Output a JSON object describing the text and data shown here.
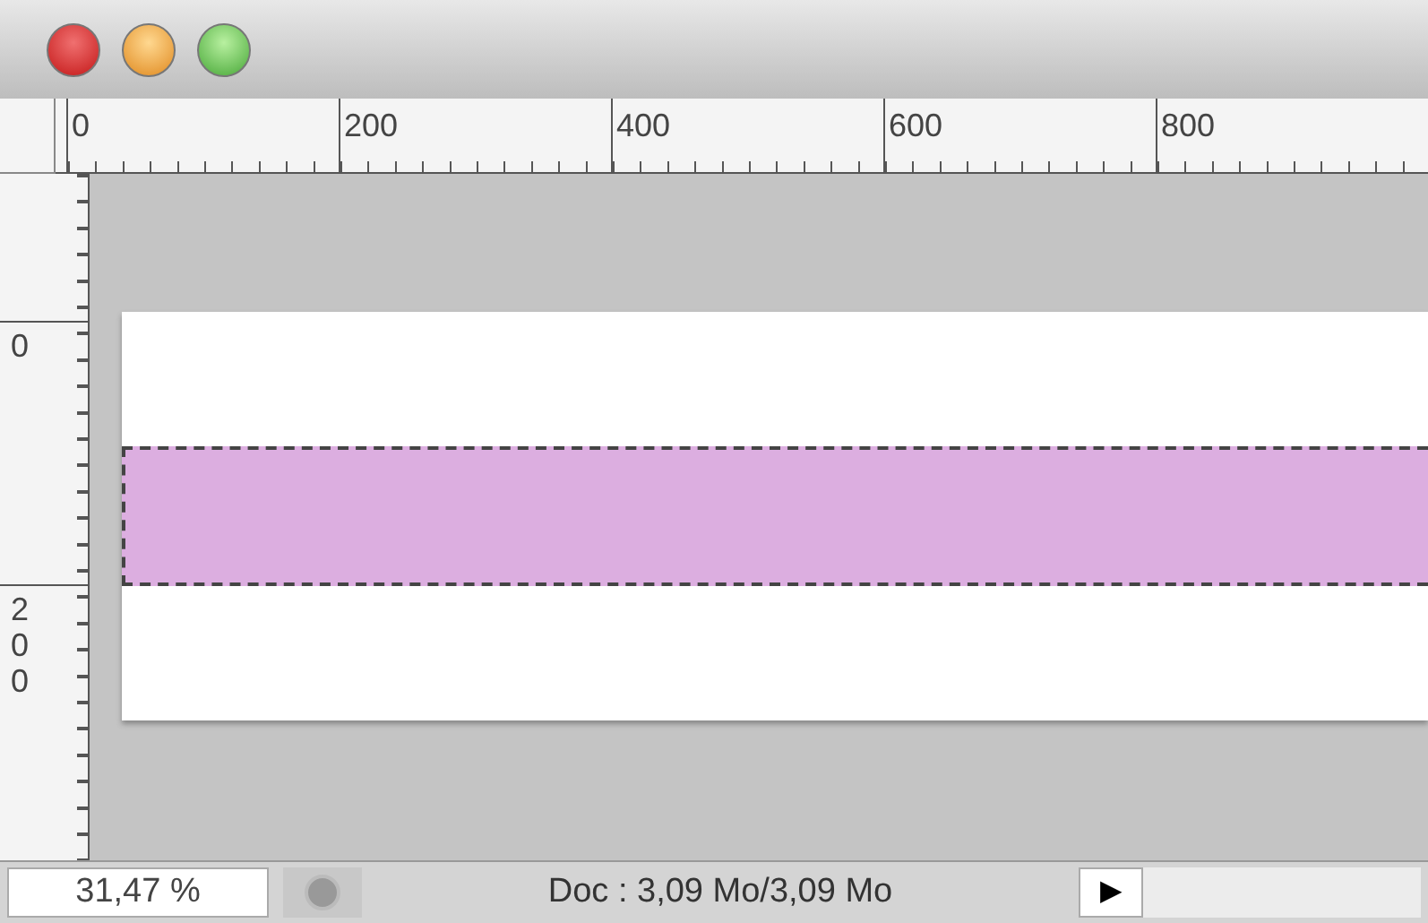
{
  "rulers": {
    "horizontal": [
      "0",
      "200",
      "400",
      "600",
      "800"
    ],
    "vertical": [
      "0",
      "200"
    ]
  },
  "document": {
    "selection": {
      "kind": "marquee"
    }
  },
  "status_bar": {
    "zoom": "31,47 %",
    "doc_info": "Doc : 3,09 Mo/3,09 Mo",
    "menu_arrow": "▶"
  }
}
